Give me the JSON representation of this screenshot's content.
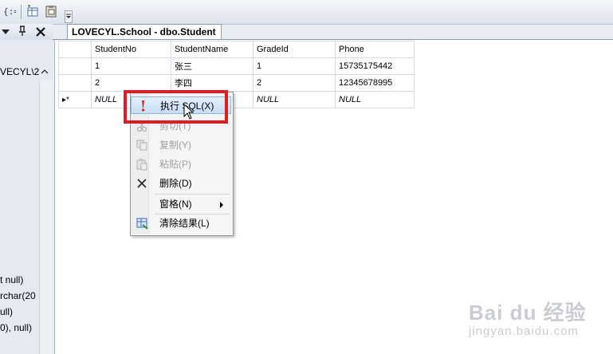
{
  "toolbar": {
    "icons": [
      "list-icon",
      "table-add-icon",
      "paste-table-icon",
      "overflow-dropdown-icon"
    ]
  },
  "left_panel": {
    "path_text": "VECYL\\2",
    "column_fragments": [
      "t null)",
      "rchar(20",
      "ull)",
      "0), null)"
    ]
  },
  "document_tab": {
    "title": "LOVECYL.School - dbo.Student"
  },
  "grid": {
    "columns": [
      "StudentNo",
      "StudentName",
      "GradeId",
      "Phone"
    ],
    "rows": [
      {
        "marker": "",
        "cells": [
          "1",
          "张三",
          "1",
          "15735175442"
        ]
      },
      {
        "marker": "",
        "cells": [
          "2",
          "李四",
          "2",
          "12345678995"
        ]
      },
      {
        "marker": "▸*",
        "cells": [
          "NULL",
          "NULL",
          "NULL",
          "NULL"
        ]
      }
    ]
  },
  "context_menu": {
    "items": [
      {
        "label": "执行 SQL(X)",
        "icon": "exclamation-icon",
        "enabled": true,
        "highlighted": true
      },
      {
        "label": "剪切(T)",
        "icon": "cut-icon",
        "enabled": false
      },
      {
        "label": "复制(Y)",
        "icon": "copy-icon",
        "enabled": false
      },
      {
        "label": "粘贴(P)",
        "icon": "paste-icon",
        "enabled": false
      },
      {
        "label": "删除(D)",
        "icon": "delete-x-icon",
        "enabled": true
      },
      {
        "label": "窗格(N)",
        "icon": "",
        "enabled": true,
        "submenu": true
      },
      {
        "label": "清除结果(L)",
        "icon": "clear-results-icon",
        "enabled": true
      }
    ]
  },
  "watermark": {
    "logo": "Bai du 经验",
    "url": "jingyan.baidu.com"
  },
  "colors": {
    "highlight_box": "#e01b22",
    "menu_hover": "#c8ddf6"
  }
}
